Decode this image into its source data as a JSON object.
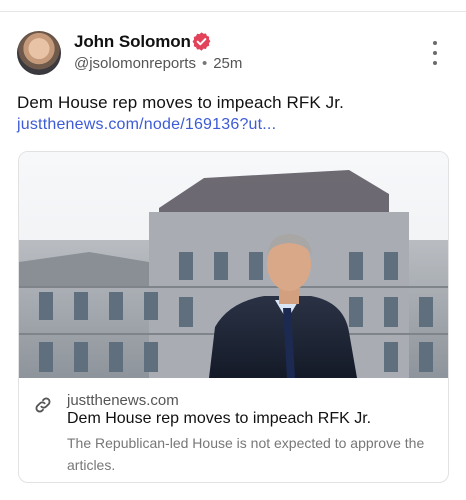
{
  "post": {
    "author": {
      "name": "John Solomon",
      "handle": "@jsolomonreports",
      "separator": "•",
      "time_ago": "25m"
    },
    "text": "Dem House rep moves to impeach RFK Jr.",
    "link_text": "justthenews.com/node/169136?ut...",
    "card": {
      "domain": "justthenews.com",
      "title": "Dem House rep moves to impeach RFK Jr.",
      "description": "The Republican-led House is not expected to approve the articles."
    }
  },
  "colors": {
    "verified_badge": "#e2435a",
    "link": "#3d5bd6",
    "secondary_text": "#555555"
  },
  "icons": {
    "verified": "verified-badge-icon",
    "more": "more-options-icon",
    "link": "link-icon"
  }
}
